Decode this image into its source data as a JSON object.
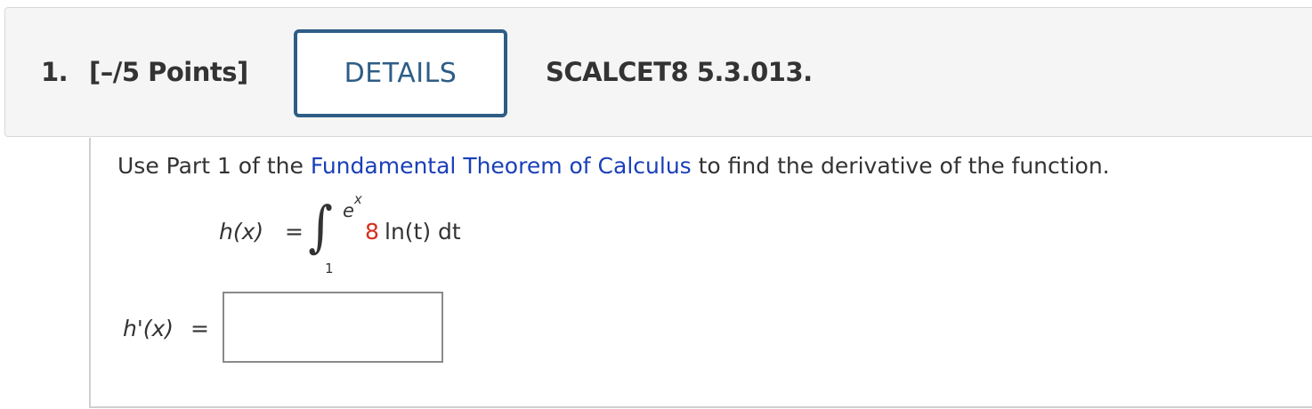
{
  "header": {
    "question_number": "1.",
    "points": "[–/5 Points]",
    "details_label": "DETAILS",
    "problem_code": "SCALCET8 5.3.013."
  },
  "question": {
    "instruction_prefix": "Use Part 1 of the ",
    "link_text": "Fundamental Theorem of Calculus",
    "instruction_suffix": " to find the derivative of the function.",
    "function_name": "h(x)",
    "equals": "=",
    "integral_sign": "∫",
    "upper_limit_base": "e",
    "upper_limit_exp": "x",
    "lower_limit": "1",
    "coefficient": "8",
    "integrand_text": " ln(t) dt",
    "answer_label": "h'(x)",
    "answer_value": ""
  },
  "colors": {
    "details_border": "#2e5d86",
    "link": "#1a3fb8",
    "coefficient": "#d32f1e",
    "header_bg": "#f5f5f5"
  }
}
